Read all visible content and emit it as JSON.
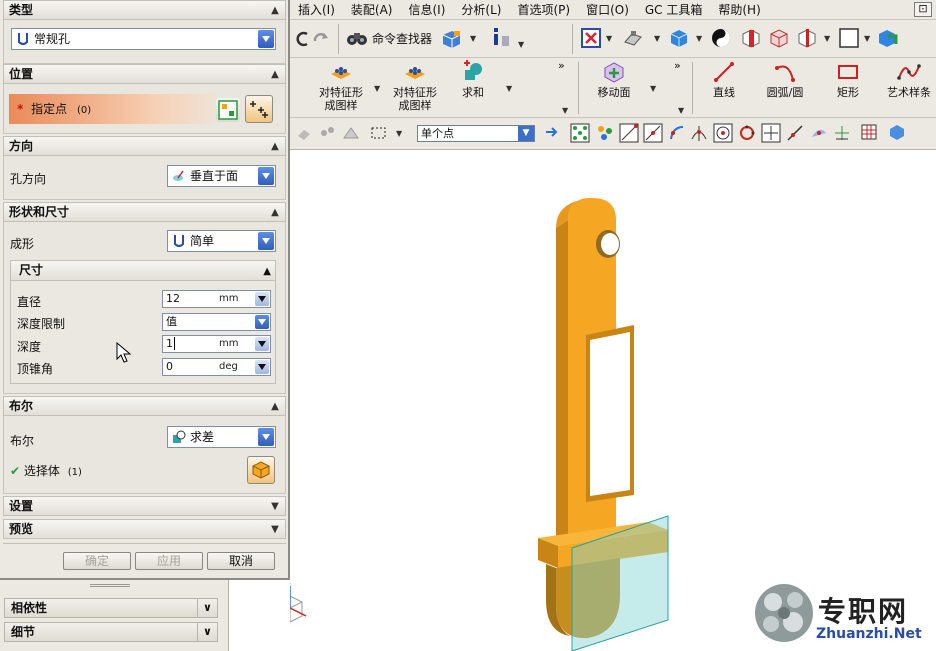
{
  "menubar": {
    "items": [
      "插入(I)",
      "装配(A)",
      "信息(I)",
      "分析(L)",
      "首选项(P)",
      "窗口(O)",
      "GC 工具箱",
      "帮助(H)"
    ],
    "window_control": "⊡"
  },
  "toolbar1": {
    "command_finder_label": "命令查找器"
  },
  "toolbar2": {
    "buttons": [
      {
        "label_line1": "对特征形",
        "label_line2": "成图样"
      },
      {
        "label_line1": "对特征形",
        "label_line2": "成图样"
      },
      {
        "label_line1": "求和",
        "label_line2": ""
      },
      {
        "label_line1": "移动面",
        "label_line2": ""
      },
      {
        "label_line1": "直线",
        "label_line2": ""
      },
      {
        "label_line1": "圆弧/圆",
        "label_line2": ""
      },
      {
        "label_line1": "矩形",
        "label_line2": ""
      },
      {
        "label_line1": "艺术样条",
        "label_line2": ""
      }
    ],
    "overflow": "»"
  },
  "toolbar3": {
    "filter_value": "单个点"
  },
  "dialog": {
    "type": {
      "header": "类型",
      "value": "常规孔"
    },
    "position": {
      "header": "位置",
      "point_label": "指定点",
      "point_count": "(0)"
    },
    "direction": {
      "header": "方向",
      "label": "孔方向",
      "value": "垂直于面"
    },
    "shape": {
      "header": "形状和尺寸",
      "form_label": "成形",
      "form_value": "简单",
      "dimensions_header": "尺寸",
      "diameter_label": "直径",
      "diameter_value": "12",
      "diameter_unit": "mm",
      "depth_limit_label": "深度限制",
      "depth_limit_value": "值",
      "depth_label": "深度",
      "depth_value": "1",
      "depth_unit": "mm",
      "tip_angle_label": "顶锥角",
      "tip_angle_value": "0",
      "tip_angle_unit": "deg"
    },
    "boolean": {
      "header": "布尔",
      "label": "布尔",
      "value": "求差",
      "select_body_label": "选择体",
      "select_body_count": "(1)"
    },
    "settings_header": "设置",
    "preview_header": "预览",
    "buttons": {
      "ok": "确定",
      "apply": "应用",
      "cancel": "取消"
    }
  },
  "left_strip": {
    "dependency_label": "相依性",
    "details_label": "细节"
  },
  "watermark": {
    "text": "专职网",
    "url": "Zhuanzhi.Net"
  },
  "colors": {
    "part_orange": "#f5a623",
    "part_dark": "#c98416",
    "preview_cyan": "#7fd3d3",
    "dialog_bg": "#ece9e3",
    "accent_blue": "#3d6fc9",
    "point_highlight": "#e98b5a"
  }
}
